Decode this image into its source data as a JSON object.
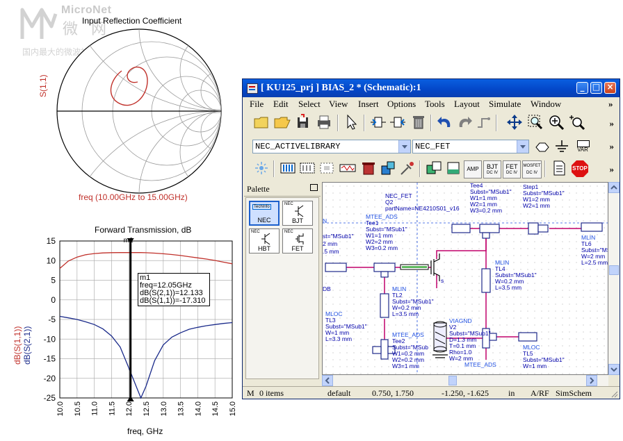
{
  "watermark": {
    "name": "MicroNet",
    "cn": "微 网",
    "sub": "国内最大的微波社区"
  },
  "smith_chart": {
    "title": "Input Reflection Coefficient",
    "ylabel": "S(1,1)",
    "xlabel": "freq (10.00GHz to 15.00GHz)",
    "trace_color": "#c0302a"
  },
  "chart_data": {
    "type": "line",
    "title": "Forward Transmission, dB",
    "xlabel": "freq, GHz",
    "ylabel": "dB(S(1,1))\ndB(S(2,1))",
    "ylabel_top": "dB(S(1,1))",
    "ylabel_bottom": "dB(S(2,1))",
    "xlim": [
      10.0,
      15.0
    ],
    "ylim": [
      -25,
      15
    ],
    "xticks": [
      "10.0",
      "10.5",
      "11.0",
      "11.5",
      "12.0",
      "12.5",
      "13.0",
      "13.5",
      "14.0",
      "14.5",
      "15.0"
    ],
    "yticks": [
      "15",
      "10",
      "5",
      "0",
      "-5",
      "-10",
      "-15",
      "-20",
      "-25"
    ],
    "x": [
      10.0,
      10.25,
      10.5,
      10.75,
      11.0,
      11.25,
      11.5,
      11.75,
      12.0,
      12.25,
      12.35,
      12.5,
      12.75,
      13.0,
      13.25,
      13.5,
      13.75,
      14.0,
      14.25,
      14.5,
      14.75,
      15.0
    ],
    "series": [
      {
        "color": "#c0302a",
        "values": [
          8.0,
          9.9,
          10.9,
          11.5,
          11.8,
          11.95,
          12.02,
          12.05,
          12.05,
          12.05,
          12.04,
          12.0,
          11.9,
          11.75,
          11.55,
          11.3,
          11.0,
          10.7,
          10.4,
          10.05,
          9.6,
          9.2
        ]
      },
      {
        "color": "#1a2a8a",
        "values": [
          -4.2,
          -4.6,
          -5.0,
          -5.6,
          -6.3,
          -7.4,
          -9.2,
          -12.0,
          -17.31,
          -22.8,
          -25.0,
          -22.0,
          -15.5,
          -11.5,
          -9.5,
          -8.4,
          -7.5,
          -7.0,
          -6.6,
          -6.3,
          -6.0,
          -5.8
        ]
      }
    ],
    "marker": {
      "name": "m1",
      "freq_text": "freq=12.05GHz",
      "s21_text": "dB(S(2,1))=12.133",
      "s11_text": "dB(S(1,1))=-17.310",
      "x": 12.05
    }
  },
  "window": {
    "title": "[ KU125_prj ] BIAS_2 * (Schematic):1",
    "menu": [
      "File",
      "Edit",
      "Select",
      "View",
      "Insert",
      "Options",
      "Tools",
      "Layout",
      "Simulate",
      "Window"
    ],
    "more": "»",
    "library_combo": "NEC_ACTIVELIBRARY",
    "component_combo": "NEC_FET",
    "var_label": "VAR",
    "palette_title": "Palette",
    "palette_items": [
      {
        "top": "TechInfo",
        "label": "NEC"
      },
      {
        "top": "NEC",
        "label": "BJT"
      },
      {
        "top": "NEC",
        "label": "HBT"
      },
      {
        "top": "NEC",
        "label": "FET"
      }
    ],
    "toolbar_labels": {
      "amp": "AMP",
      "bjt": "BJT",
      "bjt_sub": "DC IV",
      "fet": "FET",
      "fet_sub": "DC IV",
      "mosfet": "MOSFET",
      "mosfet_sub": "DC IV",
      "stop": "STOP"
    },
    "status": {
      "mode": "M",
      "items": "0 items",
      "layer": "default",
      "coord1": "0.750, 1.750",
      "coord2": "-1.250, -1.625",
      "units": "in",
      "path": "A/RF",
      "tool": "SimSchem"
    },
    "schematic": {
      "nec_fet": [
        "NEC_FET",
        "Q2",
        "partName=NE4210S01_v16"
      ],
      "tee1": [
        "MTEE_ADS",
        "Tee1",
        "Subst=\"MSub1\"",
        "W1=1 mm",
        "W2=2 mm",
        "W3=0.2 mm"
      ],
      "tee4": [
        "Tee4",
        "Subst=\"MSub1\"",
        "W1=1 mm",
        "W2=1 mm",
        "W3=0.2 mm"
      ],
      "step1": [
        "Step1",
        "Subst=\"MSub1\"",
        "W1=2 mm",
        "W2=1 mm"
      ],
      "left_frag": [
        "N",
        "st=\"MSub1\"",
        "2 mm",
        ".5 mm"
      ],
      "tl2": [
        "MLIN",
        "TL2",
        "Subst=\"MSub1\"",
        "W=0.2 mm",
        "L=3.5 mm"
      ],
      "tl4": [
        "MLIN",
        "TL4",
        "Subst=\"MSub1\"",
        "W=0.2 mm",
        "L=3.5 mm"
      ],
      "tl6": [
        "MLIN",
        "TL6",
        "Subst=\"MSub1\"",
        "W=2 mm",
        "L=2.5 mm"
      ],
      "tl3": [
        "MLOC",
        "TL3",
        "Subst=\"MSub1\"",
        "W=1 mm",
        "L=3.3 mm"
      ],
      "tl5": [
        "MLOC",
        "TL5",
        "Subst=\"MSub1\"",
        "W=1 mm"
      ],
      "tee2": [
        "MTEE_ADS",
        "Tee2",
        "Subst=\"MSub",
        "W1=0.2 mm",
        "W2=0.2 mm",
        "W3=1 mm"
      ],
      "v2": [
        "VIAGND",
        "V2",
        "Subst=\"MSub1\"",
        "D=1.3 mm",
        "T=0.1 mm",
        "Rho=1.0",
        "W=2 mm"
      ],
      "mtee_bottom": "MTEE_ADS",
      "db_frag": "DB",
      "s_label": "s"
    }
  }
}
